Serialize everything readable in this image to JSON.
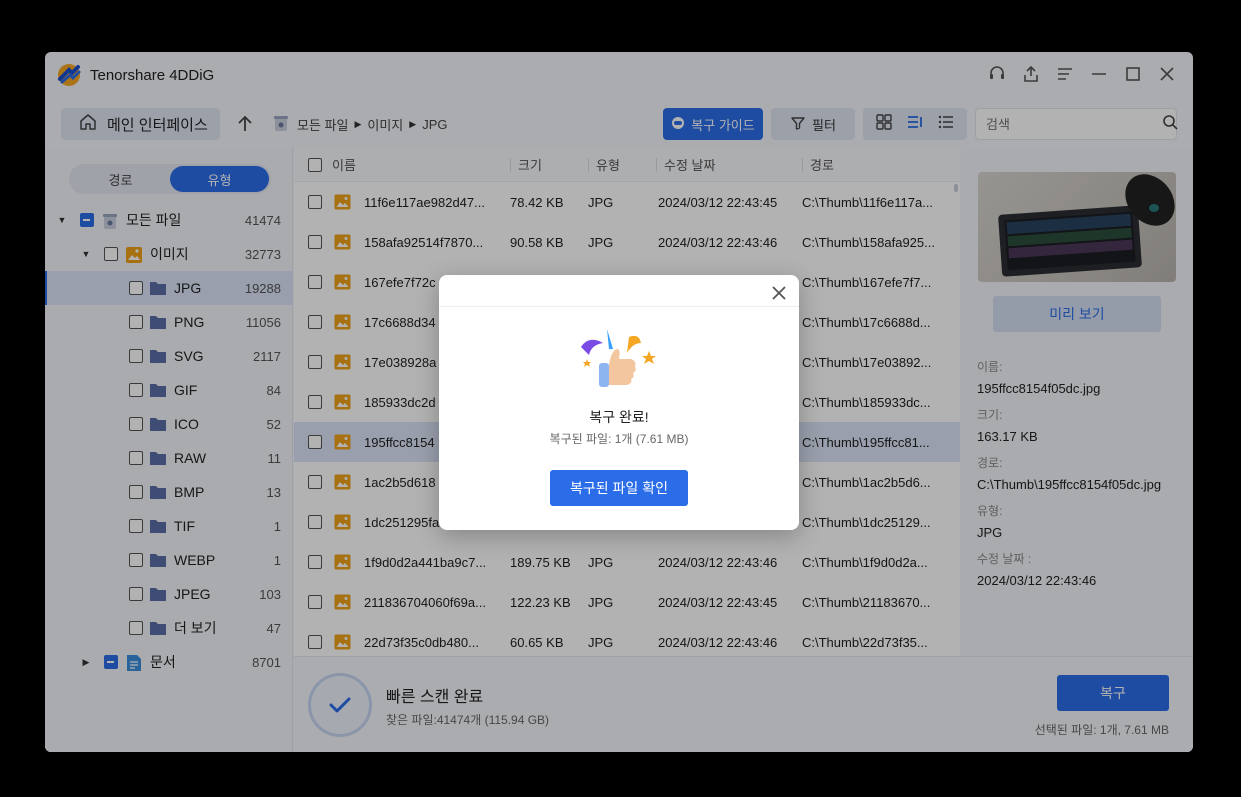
{
  "app": {
    "title": "Tenorshare 4DDiG"
  },
  "toolbar": {
    "home_label": "메인 인터페이스",
    "breadcrumb": [
      "모든 파일",
      "이미지",
      "JPG"
    ],
    "guide_label": "복구 가이드",
    "filter_label": "필터",
    "search_placeholder": "검색"
  },
  "sidebar": {
    "tabs": [
      "경로",
      "유형"
    ],
    "active_tab": "유형",
    "tree": [
      {
        "label": "모든 파일",
        "count": "41474"
      },
      {
        "label": "이미지",
        "count": "32773"
      },
      {
        "label": "JPG",
        "count": "19288"
      },
      {
        "label": "PNG",
        "count": "11056"
      },
      {
        "label": "SVG",
        "count": "2117"
      },
      {
        "label": "GIF",
        "count": "84"
      },
      {
        "label": "ICO",
        "count": "52"
      },
      {
        "label": "RAW",
        "count": "11"
      },
      {
        "label": "BMP",
        "count": "13"
      },
      {
        "label": "TIF",
        "count": "1"
      },
      {
        "label": "WEBP",
        "count": "1"
      },
      {
        "label": "JPEG",
        "count": "103"
      },
      {
        "label": "더 보기",
        "count": "47"
      },
      {
        "label": "문서",
        "count": "8701"
      }
    ]
  },
  "table": {
    "columns": [
      "이름",
      "크기",
      "유형",
      "수정 날짜",
      "경로"
    ],
    "rows": [
      {
        "name": "11f6e117ae982d47...",
        "size": "78.42 KB",
        "type": "JPG",
        "date": "2024/03/12 22:43:45",
        "path": "C:\\Thumb\\11f6e117a..."
      },
      {
        "name": "158afa92514f7870...",
        "size": "90.58 KB",
        "type": "JPG",
        "date": "2024/03/12 22:43:46",
        "path": "C:\\Thumb\\158afa925..."
      },
      {
        "name": "167efe7f72c",
        "size": "",
        "type": "",
        "date": "",
        "path": "C:\\Thumb\\167efe7f7..."
      },
      {
        "name": "17c6688d34",
        "size": "",
        "type": "",
        "date": "",
        "path": "C:\\Thumb\\17c6688d..."
      },
      {
        "name": "17e038928a",
        "size": "",
        "type": "",
        "date": "",
        "path": "C:\\Thumb\\17e03892..."
      },
      {
        "name": "185933dc2d",
        "size": "",
        "type": "",
        "date": "",
        "path": "C:\\Thumb\\185933dc..."
      },
      {
        "name": "195ffcc8154",
        "size": "",
        "type": "",
        "date": "",
        "path": "C:\\Thumb\\195ffcc81..."
      },
      {
        "name": "1ac2b5d618",
        "size": "",
        "type": "",
        "date": "",
        "path": "C:\\Thumb\\1ac2b5d6..."
      },
      {
        "name": "1dc251295fa",
        "size": "",
        "type": "",
        "date": "",
        "path": "C:\\Thumb\\1dc25129..."
      },
      {
        "name": "1f9d0d2a441ba9c7...",
        "size": "189.75 KB",
        "type": "JPG",
        "date": "2024/03/12 22:43:46",
        "path": "C:\\Thumb\\1f9d0d2a..."
      },
      {
        "name": "211836704060f69a...",
        "size": "122.23 KB",
        "type": "JPG",
        "date": "2024/03/12 22:43:45",
        "path": "C:\\Thumb\\21183670..."
      },
      {
        "name": "22d73f35c0db480...",
        "size": "60.65 KB",
        "type": "JPG",
        "date": "2024/03/12 22:43:46",
        "path": "C:\\Thumb\\22d73f35..."
      }
    ]
  },
  "preview": {
    "button_label": "미리 보기",
    "name_label": "이름:",
    "name_value": "195ffcc8154f05dc.jpg",
    "size_label": "크기:",
    "size_value": "163.17 KB",
    "path_label": "경로:",
    "path_value": "C:\\Thumb\\195ffcc8154f05dc.jpg",
    "type_label": "유형:",
    "type_value": "JPG",
    "date_label": "수정 날짜 :",
    "date_value": "2024/03/12 22:43:46"
  },
  "footer": {
    "scan_title": "빠른 스캔 완료",
    "scan_sub": "찾은 파일:41474개 (115.94 GB)",
    "recover_label": "복구",
    "selected_info": "선택된 파일: 1개, 7.61 MB"
  },
  "modal": {
    "title": "복구 완료!",
    "subtitle": "복구된 파일: 1개 (7.61 MB)",
    "button_label": "복구된 파일 확인"
  },
  "colors": {
    "accent": "#2b6de8",
    "selection": "#dbe4f7",
    "folder": "#5b6fa8",
    "image_icon": "#f0a21a"
  }
}
